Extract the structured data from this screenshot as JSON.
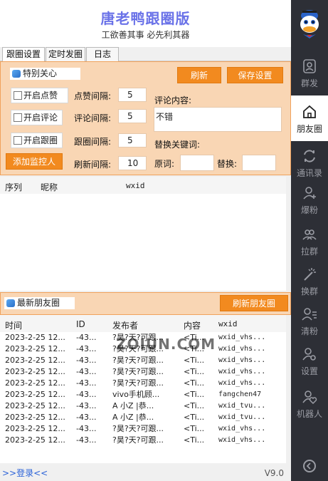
{
  "app": {
    "title": "唐老鸭跟圈版",
    "subtitle": "工欲善其事 必先利其器"
  },
  "tabs": [
    "跟圈设置",
    "定时发圈",
    "日志"
  ],
  "settings": {
    "group_label": "特别关心",
    "refresh_label": "刷新",
    "save_label": "保存设置",
    "auto_like_label": "开启点赞",
    "auto_comment_label": "开启评论",
    "auto_follow_label": "开启跟圈",
    "add_monitor_label": "添加监控人",
    "like_interval_label": "点赞间隔:",
    "like_interval_value": "5",
    "comment_interval_label": "评论间隔:",
    "comment_interval_value": "5",
    "follow_interval_label": "跟圈间隔:",
    "follow_interval_value": "5",
    "refresh_interval_label": "刷新间隔:",
    "refresh_interval_value": "10",
    "comment_content_label": "评论内容:",
    "comment_content_value": "不错",
    "replace_keywords_label": "替换关键词:",
    "original_label": "原词:",
    "replace_label": "替换:"
  },
  "monitor_table": {
    "headers": [
      "序列",
      "昵称",
      "wxid"
    ]
  },
  "moments": {
    "group_label": "最新朋友圈",
    "refresh_label": "刷新朋友圈",
    "headers": [
      "时间",
      "ID",
      "发布者",
      "内容",
      "wxid"
    ],
    "rows": [
      [
        "2023-2-25 12...",
        "-43...",
        "?昊?天?可跟...",
        "<Ti...",
        "wxid_vhs..."
      ],
      [
        "2023-2-25 12...",
        "-43...",
        "?昊?天?可跟...",
        "<Ti...",
        "wxid_vhs..."
      ],
      [
        "2023-2-25 12...",
        "-43...",
        "?昊?天?可跟...",
        "<Ti...",
        "wxid_vhs..."
      ],
      [
        "2023-2-25 12...",
        "-43...",
        "?昊?天?可跟...",
        "<Ti...",
        "wxid_vhs..."
      ],
      [
        "2023-2-25 12...",
        "-43...",
        "?昊?天?可跟...",
        "<Ti...",
        "wxid_vhs..."
      ],
      [
        "2023-2-25 12...",
        "-43...",
        "vivo手机顾...",
        "<Ti...",
        "fangchen47"
      ],
      [
        "2023-2-25 12...",
        "-43...",
        "A 小Z  |恭...",
        "<Ti...",
        "wxid_tvu..."
      ],
      [
        "2023-2-25 12...",
        "-43...",
        "A 小Z  |恭...",
        "<Ti...",
        "wxid_tvu..."
      ],
      [
        "2023-2-25 12...",
        "-43...",
        "?昊?天?可跟...",
        "<Ti...",
        "wxid_vhs..."
      ],
      [
        "2023-2-25 12...",
        "-43...",
        "?昊?天?可跟...",
        "<Ti...",
        "wxid_vhs..."
      ]
    ]
  },
  "watermark": "ZOIUN.COM",
  "footer": {
    "login_label": ">>登录<<",
    "version": "V9.0"
  },
  "sidebar": {
    "items": [
      {
        "label": "群发",
        "icon": "user-send-icon"
      },
      {
        "label": "朋友圈",
        "icon": "home-icon"
      },
      {
        "label": "通讯录",
        "icon": "sync-icon"
      },
      {
        "label": "爆粉",
        "icon": "user-add-icon"
      },
      {
        "label": "拉群",
        "icon": "group-icon"
      },
      {
        "label": "换群",
        "icon": "magic-wand-icon"
      },
      {
        "label": "清粉",
        "icon": "user-list-icon"
      },
      {
        "label": "设置",
        "icon": "user-gear-icon"
      },
      {
        "label": "机器人",
        "icon": "user-heart-icon"
      }
    ]
  },
  "colors": {
    "accent": "#f28a1f",
    "panel_bg": "#f9d6b4",
    "sidebar_bg": "#2d2f36",
    "title": "#6a72e8"
  }
}
